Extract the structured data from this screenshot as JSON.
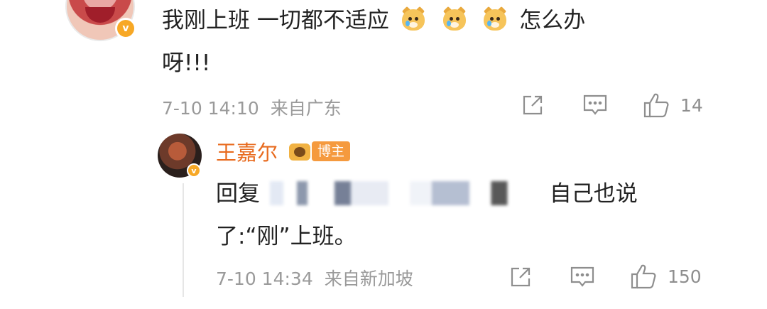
{
  "comment": {
    "line1_before": "我刚上班 一切都不适应",
    "line1_after": "怎么办",
    "line2": "呀!!!",
    "emoji_name": "crying-doge-emoji",
    "time": "7-10 14:10",
    "source": "来自广东",
    "likes": "14"
  },
  "reply": {
    "username": "王嘉尔",
    "badge_label": "博主",
    "prefix": "回复",
    "line1_end": "自己也说",
    "line2": "了:“刚”上班。",
    "time": "7-10 14:34",
    "source": "来自新加坡",
    "likes": "150"
  },
  "colors": {
    "username": "#e86b1f",
    "verified_badge": "#f7a826",
    "meta_text": "#9a9a9a"
  },
  "icons": [
    "share-icon",
    "comment-icon",
    "like-icon",
    "verified-badge-icon",
    "blogger-crown-icon"
  ]
}
